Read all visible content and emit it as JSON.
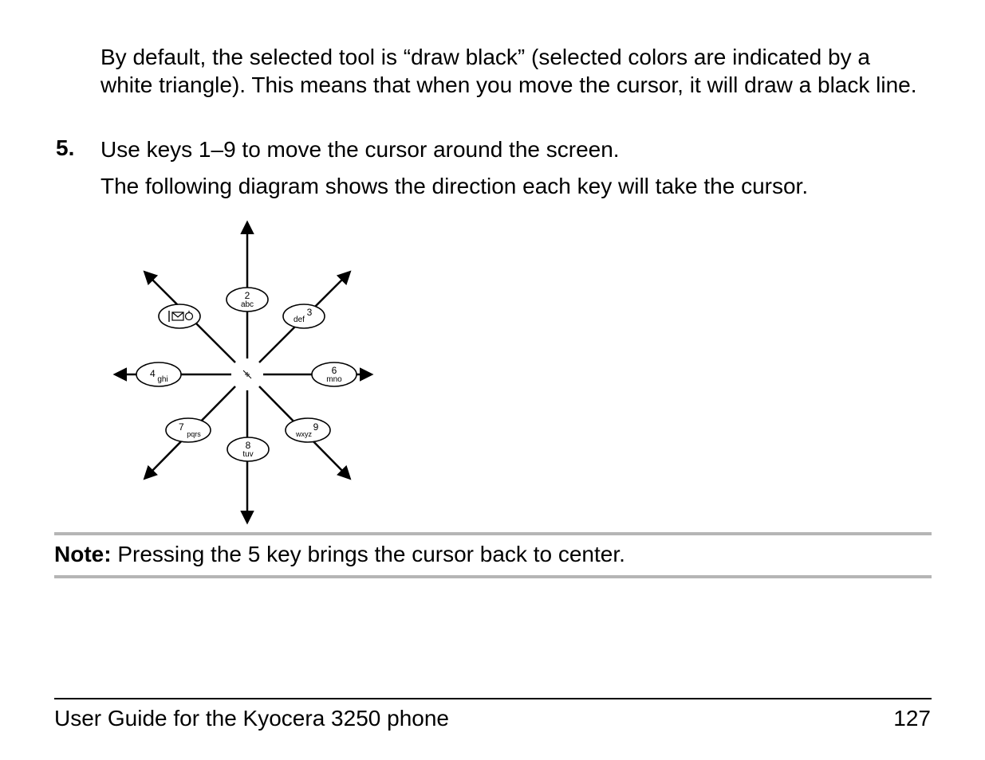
{
  "text": {
    "intro": "By default, the selected tool is “draw black” (selected colors are indicated by a white triangle). This means that when you move the cursor, it will draw a black line.",
    "step_number": "5.",
    "step": "Use keys 1–9 to move the cursor around the screen.",
    "step_sub": "The following diagram shows the direction each key will take the cursor.",
    "note_label": "Note:",
    "note_body": " Pressing the 5 key brings the cursor back to center."
  },
  "footer": {
    "title": "User Guide for the Kyocera 3250 phone",
    "page_number": "127"
  },
  "diagram": {
    "keys": [
      {
        "n": "1",
        "label_top": "",
        "label_bot": "",
        "glyph": "mail",
        "dir": "up-left"
      },
      {
        "n": "2",
        "label_top": "2",
        "label_bot": "abc",
        "glyph": "",
        "dir": "up"
      },
      {
        "n": "3",
        "label_top": "3",
        "label_bot": "def",
        "glyph": "",
        "dir": "up-right"
      },
      {
        "n": "4",
        "label_top": "4",
        "label_bot": "ghi",
        "glyph": "",
        "dir": "left"
      },
      {
        "n": "6",
        "label_top": "6",
        "label_bot": "mno",
        "glyph": "",
        "dir": "right"
      },
      {
        "n": "7",
        "label_top": "7",
        "label_bot": "pqrs",
        "glyph": "",
        "dir": "down-left"
      },
      {
        "n": "8",
        "label_top": "8",
        "label_bot": "tuv",
        "glyph": "",
        "dir": "down"
      },
      {
        "n": "9",
        "label_top": "9",
        "label_bot": "wxyz",
        "glyph": "",
        "dir": "down-right"
      }
    ]
  }
}
